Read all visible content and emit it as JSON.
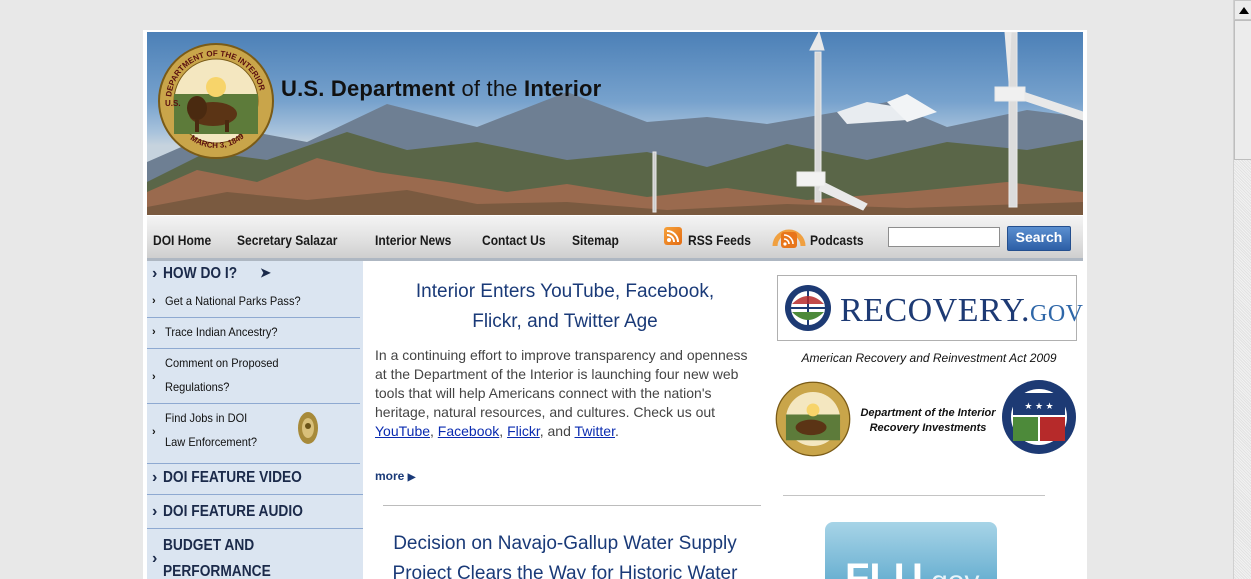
{
  "banner": {
    "title_bold_1": "U.S. Department",
    "title_normal": " of the ",
    "title_bold_2": "Interior",
    "seal_text_top": "DEPARTMENT OF THE INTERIOR",
    "seal_text_bottom": "MARCH 3, 1849",
    "seal_text_left": "U.S."
  },
  "nav": {
    "items": [
      "DOI Home",
      "Secretary Salazar",
      "Interior News",
      "Contact Us",
      "Sitemap"
    ],
    "rss_label": "RSS Feeds",
    "podcasts_label": "Podcasts",
    "search_value": "",
    "search_button": "Search"
  },
  "sidebar": {
    "how_do_i": "HOW DO I?",
    "items": [
      "Get a National Parks Pass?",
      "Trace Indian Ancestry?",
      "Comment on Proposed",
      "Regulations?",
      "Find Jobs in DOI",
      "Law Enforcement?"
    ],
    "feature_video": "DOI FEATURE VIDEO",
    "feature_audio": "DOI FEATURE AUDIO",
    "budget_line1": "BUDGET AND",
    "budget_line2": "PERFORMANCE"
  },
  "main": {
    "story1_title_line1": "Interior Enters YouTube, Facebook,",
    "story1_title_line2": "Flickr, and Twitter Age",
    "story1_body": "In a continuing effort to improve transparency and openness at the Department of the Interior is launching four new web tools that will help Americans connect with the nation's heritage, natural resources, and cultures. Check us out ",
    "links": [
      "YouTube",
      "Facebook",
      "Flickr",
      "Twitter"
    ],
    "sep1": ", ",
    "sep_and": ", and ",
    "period": ".",
    "more": "more",
    "story2_title_line1": "Decision on Navajo-Gallup Water Supply",
    "story2_title_line2": "Project Clears the Way for Historic Water"
  },
  "right": {
    "recovery_main": "RECOVERY.",
    "recovery_gov": "GOV",
    "arra": "American Recovery and Reinvestment Act 2009",
    "doi_recov_line1": "Department of the Interior",
    "doi_recov_line2": "Recovery Investments",
    "flu_main": "FLU",
    "flu_gov": ".gov"
  }
}
